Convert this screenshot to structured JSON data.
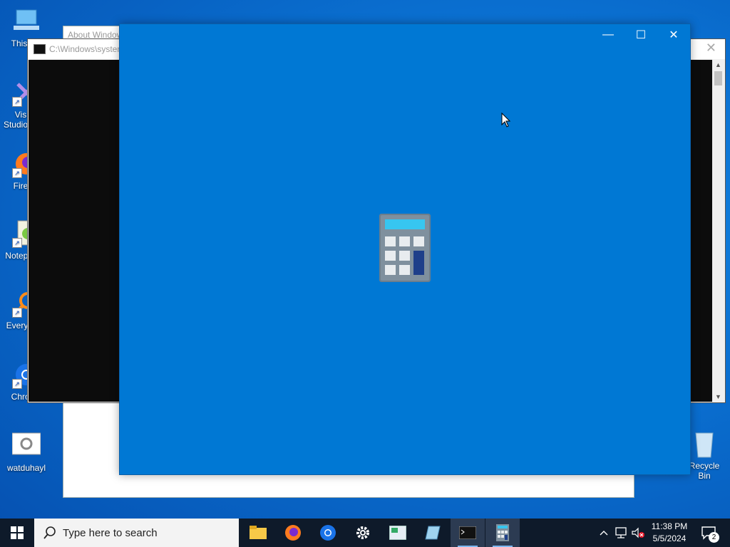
{
  "desktop": {
    "icons": [
      {
        "label": "This PC",
        "name": "this-pc"
      },
      {
        "label": "Visual Studio 2022",
        "name": "visual-studio"
      },
      {
        "label": "Firefox",
        "name": "firefox"
      },
      {
        "label": "Notepad++",
        "name": "notepad-plus-plus"
      },
      {
        "label": "Everything",
        "name": "everything"
      },
      {
        "label": "Chrome",
        "name": "chrome"
      },
      {
        "label": "watduhayl",
        "name": "watduhayl"
      }
    ],
    "recycle_bin_label": "Recycle Bin"
  },
  "about_window": {
    "title": "About Windows"
  },
  "cmd_window": {
    "title": "C:\\Windows\\system32\\cmd.exe"
  },
  "calculator_window": {
    "app_icon": "calculator-icon",
    "minimize_glyph": "—",
    "maximize_glyph": "☐",
    "close_glyph": "✕"
  },
  "taskbar": {
    "search_placeholder": "Type here to search",
    "pinned": [
      "file-explorer-icon",
      "firefox-icon",
      "chrome-icon",
      "settings-icon",
      "news-icon",
      "notepad-icon",
      "cmd-icon",
      "calculator-icon"
    ],
    "clock_time": "11:38 PM",
    "clock_date": "5/5/2024",
    "notification_count": "2"
  },
  "colors": {
    "calc_splash_bg": "#0078d4",
    "taskbar_bg": "#0e1a2a",
    "desktop_bg": "#0a6fd0"
  }
}
